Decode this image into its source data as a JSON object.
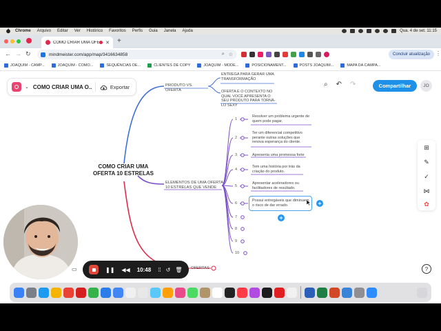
{
  "menubar": {
    "app": "Chrome",
    "items": [
      "Arquivo",
      "Editar",
      "Ver",
      "Histórico",
      "Favoritos",
      "Perfis",
      "Guia",
      "Janela",
      "Ajuda"
    ],
    "clock": "Qua. 4 de set.  11:15"
  },
  "browser": {
    "tab_title": "COMO CRIAR UMA OFER",
    "new_tab": "+",
    "url": "mindmeister.com/app/map/3416634858",
    "update_button": "Concluir atualização",
    "bookmarks": [
      {
        "label": "JOAQUIM - CAMP...",
        "color": "#2c6be0"
      },
      {
        "label": "JOAQUIM - COMO...",
        "color": "#2c6be0"
      },
      {
        "label": "SEQUÊNCIAS DE...",
        "color": "#2c6be0"
      },
      {
        "label": "CLIENTES DE COPY",
        "color": "#1e9e4a"
      },
      {
        "label": "JOAQUIM - MODE...",
        "color": "#2c6be0"
      },
      {
        "label": "POSICIONAMENT...",
        "color": "#2c6be0"
      },
      {
        "label": "POSTS JOAQUIM...",
        "color": "#2c6be0"
      },
      {
        "label": "MAPA DA CAMPA...",
        "color": "#2c6be0"
      }
    ]
  },
  "app": {
    "map_name": "COMO CRIAR UMA O...",
    "export_label": "Exportar",
    "share_label": "Compartilhar",
    "avatar_initials": "JO",
    "help": "?"
  },
  "map": {
    "root": "COMO CRIAR UMA OFERTA 10 ESTRELAS",
    "branch_product": "PRODUTO VS. OFERTA",
    "product_child_1": "ENTREGA PARA GERAR UMA TRANSFORMAÇÃO",
    "product_child_2": "OFERTA É O CONTEXTO NO QUAL VOCÊ APRESENTA O SEU PRODUTO PARA TORNÁ-LO SEXY",
    "branch_elements": "ELEMENTOS DE UMA OFERTA 10 ESTRELAS QUE VENDE",
    "branch_offers": "OFERTAS",
    "numbers": [
      "1",
      "2",
      "3",
      "4",
      "5",
      "6",
      "7",
      "8",
      "9",
      "10"
    ],
    "element_texts": [
      "Resolver um problema urgente de quem pode pagar.",
      "Ter um diferencial competitivo perante outras soluções que renova esperança do cliente.",
      "Apresenta uma promessa forte",
      "Tem uma história por trás da criação do produto.",
      "Apresentar aceleradores ou facilitadores de resultado.",
      "Possui entregáveis que diminuem o risco de dar errado."
    ]
  },
  "recorder": {
    "time": "10:48"
  },
  "colors": {
    "accent": "#1e90e8",
    "branch_blue": "#3f6fd6",
    "branch_purple": "#7b4fc9",
    "branch_pink": "#e0284a",
    "record_red": "#e2483a"
  }
}
